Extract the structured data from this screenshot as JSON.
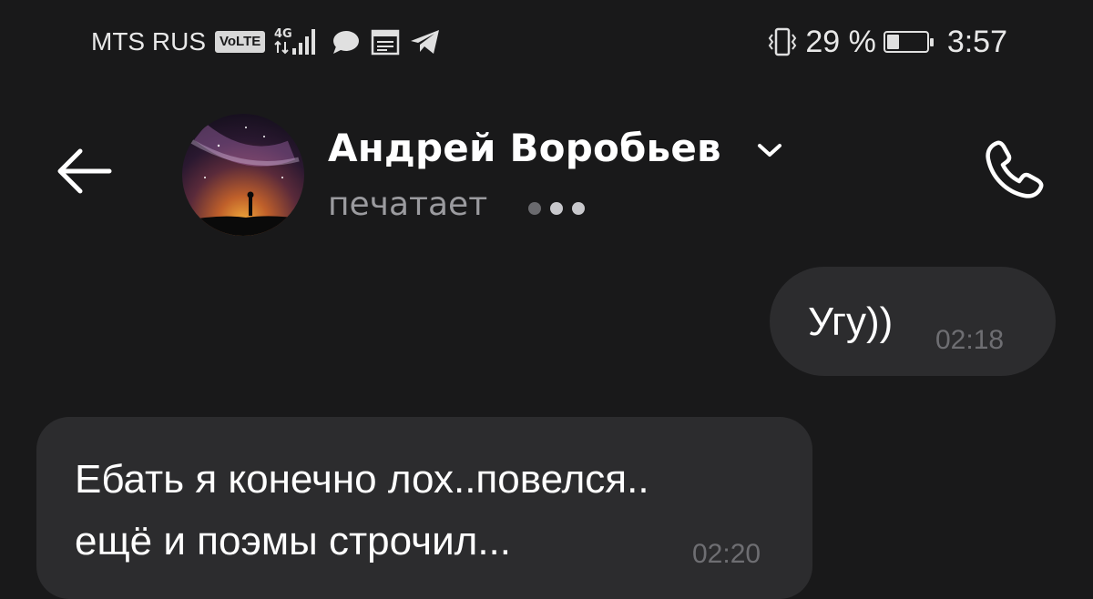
{
  "status_bar": {
    "carrier": "MTS RUS",
    "volte_badge": "VoLTE",
    "network_type": "4G",
    "battery_percent": "29 %",
    "battery_level": 0.29,
    "clock": "3:57",
    "icons": [
      "volte-icon",
      "signal-icon",
      "chat-icon",
      "calendar-icon",
      "telegram-icon",
      "vibrate-icon",
      "battery-icon"
    ]
  },
  "header": {
    "contact_name": "Андрей Воробьев",
    "status": "печатает",
    "icons": [
      "back-arrow-icon",
      "chevron-down-icon",
      "phone-icon"
    ]
  },
  "messages": [
    {
      "direction": "outgoing",
      "text": "Угу))",
      "time": "02:18"
    },
    {
      "direction": "incoming",
      "lines": [
        "Ебать я конечно лох..повелся..",
        "ещё и поэмы строчил..."
      ],
      "time": "02:20"
    }
  ],
  "colors": {
    "background": "#19191a",
    "bubble": "#2c2c2e",
    "secondary_text": "#9b9b9f",
    "timestamp": "#6e6e72",
    "typing_dot_dim": "#6a6a6e",
    "typing_dot_bright": "#c8c8cc"
  }
}
